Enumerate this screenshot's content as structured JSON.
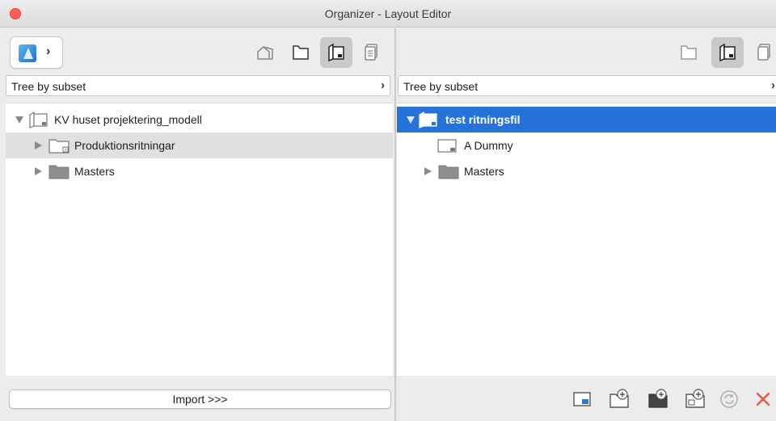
{
  "window": {
    "title": "Organizer - Layout Editor"
  },
  "left": {
    "selector": "Tree by subset",
    "tree": [
      {
        "label": "KV huset projektering_modell",
        "state": "open"
      },
      {
        "label": "Produktionsritningar",
        "state": "closed"
      },
      {
        "label": "Masters",
        "state": "closed"
      }
    ],
    "import_label": "Import >>>"
  },
  "right": {
    "selector": "Tree by subset",
    "tree": [
      {
        "label": "test ritningsfil",
        "state": "open"
      },
      {
        "label": "A Dummy",
        "state": "none"
      },
      {
        "label": "Masters",
        "state": "closed"
      }
    ]
  },
  "icons": {
    "toolbar_left": [
      "project-map-icon",
      "view-map-icon",
      "layout-book-icon",
      "publisher-sets-icon"
    ],
    "toolbar_right": [
      "view-map-icon",
      "layout-book-icon",
      "publisher-sets-icon"
    ],
    "footer_right": [
      "new-layout-icon",
      "new-subset-icon",
      "new-master-icon",
      "new-master-layout-icon",
      "update-icon",
      "delete-icon"
    ]
  },
  "colors": {
    "selection": "#2772d8",
    "delete": "#e8573f",
    "close_button": "#ff5f57"
  }
}
